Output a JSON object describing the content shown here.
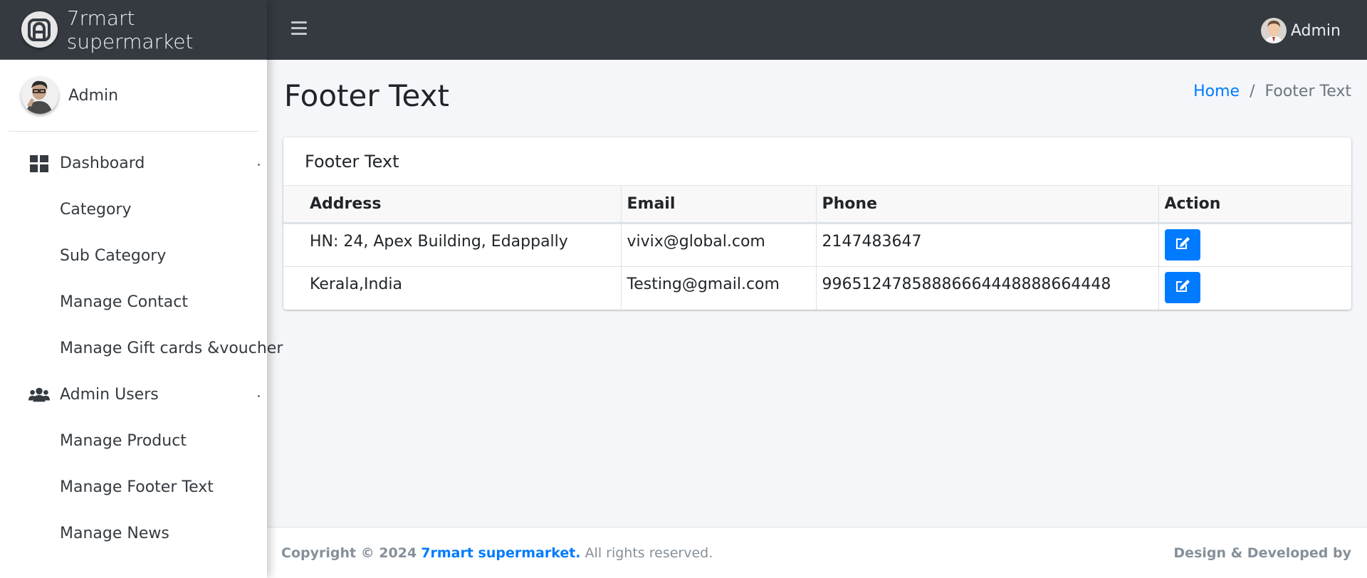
{
  "brand": {
    "name": "7rmart supermarket"
  },
  "topbar": {
    "user_name": "Admin"
  },
  "sidebar": {
    "user_name": "Admin",
    "items": [
      {
        "label": "Dashboard",
        "icon": "dashboard-icon",
        "has_children": true
      },
      {
        "label": "Category"
      },
      {
        "label": "Sub Category"
      },
      {
        "label": "Manage Contact"
      },
      {
        "label": "Manage Gift cards &voucher"
      },
      {
        "label": "Admin Users",
        "icon": "users-icon",
        "has_children": true
      },
      {
        "label": "Manage Product"
      },
      {
        "label": "Manage Footer Text"
      },
      {
        "label": "Manage News"
      }
    ]
  },
  "page": {
    "title": "Footer Text",
    "breadcrumb": {
      "home": "Home",
      "separator": "/",
      "current": "Footer Text"
    }
  },
  "card": {
    "title": "Footer Text",
    "columns": [
      "Address",
      "Email",
      "Phone",
      "Action"
    ],
    "rows": [
      {
        "address": "HN: 24, Apex Building, Edappally",
        "email": "vivix@global.com",
        "phone": "2147483647",
        "action_icon": "edit-icon"
      },
      {
        "address": "Kerala,India",
        "email": "Testing@gmail.com",
        "phone": "99651247858886664448888664448",
        "action_icon": "edit-icon"
      }
    ]
  },
  "footer": {
    "copyright_prefix": "Copyright © 2024",
    "brand_link": "7rmart supermarket.",
    "rights": "All rights reserved.",
    "right_text": "Design & Developed by"
  },
  "colors": {
    "navbar": "#343a40",
    "accent": "#007bff",
    "background": "#f4f6f9"
  }
}
